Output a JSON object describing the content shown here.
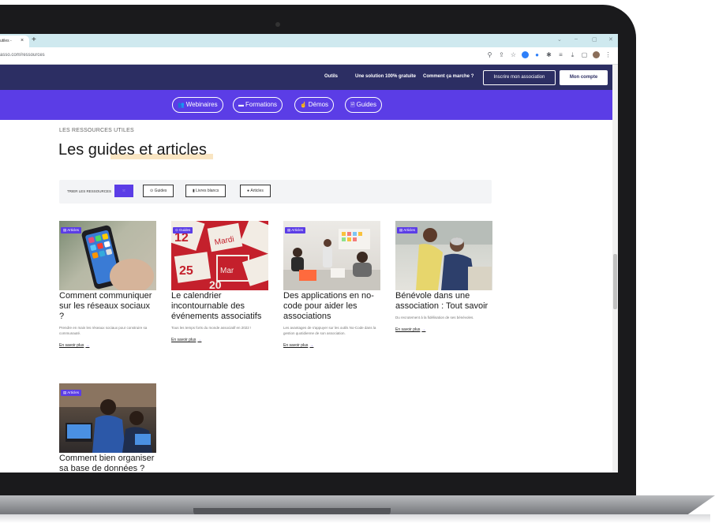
{
  "browser": {
    "tab_title": "utiles -",
    "tab_close": "×",
    "new_tab": "+",
    "url": "asso.com/ressources",
    "window_controls": [
      "⌄",
      "–",
      "▢",
      "✕"
    ]
  },
  "header": {
    "nav": [
      "Outils",
      "Une solution 100% gratuite",
      "Comment ça marche ?"
    ],
    "register_button": "Inscrire mon association",
    "account_button": "Mon compte"
  },
  "subnav": [
    {
      "icon": "👥",
      "label": "Webinaires"
    },
    {
      "icon": "▬",
      "label": "Formations"
    },
    {
      "icon": "☝",
      "label": "Démos"
    },
    {
      "icon": "🗎",
      "label": "Guides"
    }
  ],
  "main": {
    "kicker": "LES RESSOURCES UTILES",
    "title": "Les guides et articles"
  },
  "filters": {
    "label": "TRIER LES RESSOURCES",
    "all_icon": "⁙",
    "buttons": [
      {
        "icon": "⊙",
        "label": "Guides"
      },
      {
        "icon": "▮",
        "label": "Livres blancs"
      },
      {
        "icon": "●",
        "label": "Articles"
      }
    ]
  },
  "cards": [
    {
      "badge": "▤ Articles",
      "title": "Comment communiquer sur les réseaux sociaux ?",
      "desc": "Prendre en main les réseaux sociaux pour construire sa communauté.",
      "link": "En savoir plus",
      "arrow": "→"
    },
    {
      "badge": "⊙ Guides",
      "title": "Le calendrier incontournable des événements associatifs",
      "desc": "Tous les temps forts du monde associatif en 2022 !",
      "link": "En savoir plus",
      "arrow": "→"
    },
    {
      "badge": "▤ Articles",
      "title": "Des applications en no-code pour aider les associations",
      "desc": "Les avantages de s'appuyer sur les outils No-Code dans la gestion quotidienne de son association.",
      "link": "En savoir plus",
      "arrow": "→"
    },
    {
      "badge": "▤ Articles",
      "title": "Bénévole dans une association : Tout savoir",
      "desc": "Du recrutement à la fidélisation de ses bénévoles.",
      "link": "En savoir plus",
      "arrow": "→"
    },
    {
      "badge": "▤ Articles",
      "title": "Comment bien organiser sa base de données ?",
      "desc": "",
      "link": "",
      "arrow": ""
    }
  ],
  "calendar_words": [
    "Mardi",
    "12",
    "25",
    "Mar",
    "20"
  ],
  "colors": {
    "header": "#2c2e63",
    "accent": "#5b3de6",
    "highlight": "#f8dfb3"
  }
}
